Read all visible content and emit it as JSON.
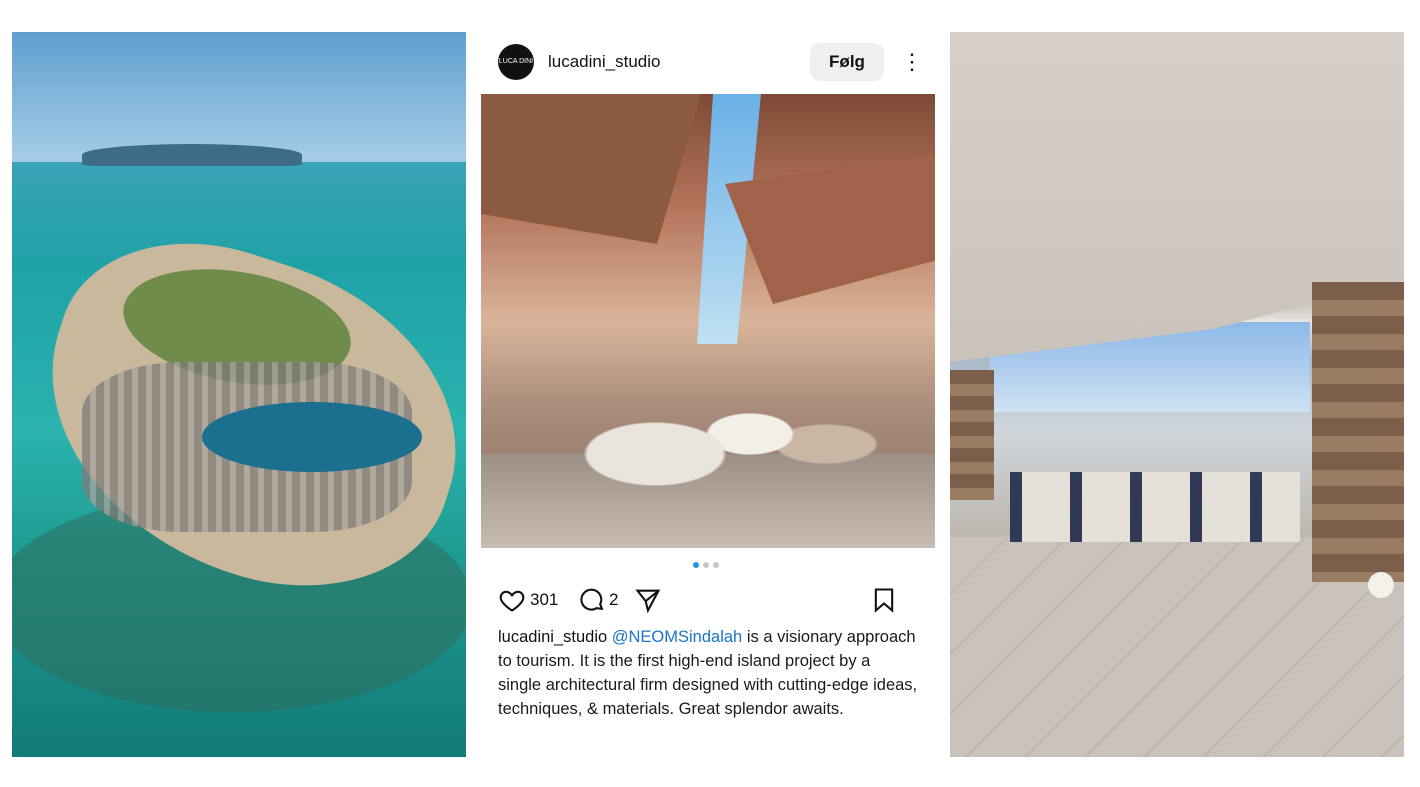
{
  "post": {
    "username": "lucadini_studio",
    "avatar_text": "LUCA DINI",
    "follow_label": "Følg",
    "more_label": "⋮",
    "carousel": {
      "count": 3,
      "active_index": 0
    },
    "likes_count": "301",
    "comments_count": "2",
    "caption": {
      "username": "lucadini_studio",
      "mention": "@NEOMSindalah",
      "text": " is a visionary approach to tourism. It is the first high-end island project by a single architectural firm designed with cutting-edge ideas, techniques, & materials. Great splendor awaits."
    },
    "icons": {
      "like": "heart-icon",
      "comment": "comment-icon",
      "share": "send-icon",
      "save": "bookmark-icon"
    }
  },
  "colors": {
    "mention": "#1a73c8",
    "active_dot": "#1e95e6",
    "follow_bg": "#efefef"
  }
}
